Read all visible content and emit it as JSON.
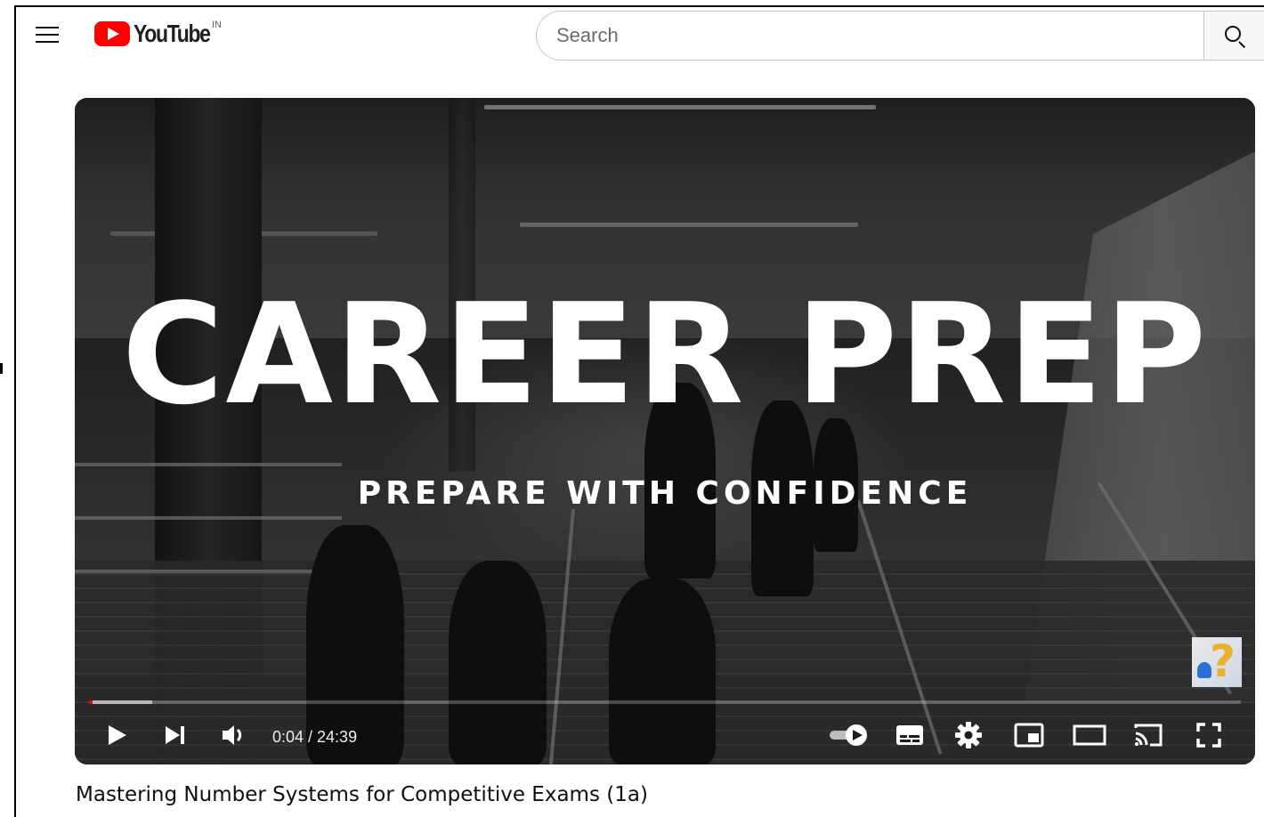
{
  "header": {
    "logo_text": "YouTube",
    "country_code": "IN",
    "search_placeholder": "Search"
  },
  "player": {
    "overlay_title": "CAREER PREP",
    "overlay_subtitle": "PREPARE WITH CONFIDENCE",
    "current_time": "0:04",
    "duration": "24:39",
    "time_display": "0:04 / 24:39",
    "progress_fraction": 0.0027,
    "buffered_fraction": 0.055,
    "progress_color": "#ff0000",
    "autoplay": "on",
    "controls": [
      "play-icon",
      "next-icon",
      "volume-icon",
      "autoplay-toggle-icon",
      "subtitles-icon",
      "settings-gear-icon",
      "miniplayer-icon",
      "theater-mode-icon",
      "cast-icon",
      "fullscreen-icon"
    ]
  },
  "video": {
    "title": "Mastering Number Systems for Competitive Exams (1a)"
  },
  "colors": {
    "brand_red": "#ff0000",
    "text_primary": "#0f0f0f"
  }
}
